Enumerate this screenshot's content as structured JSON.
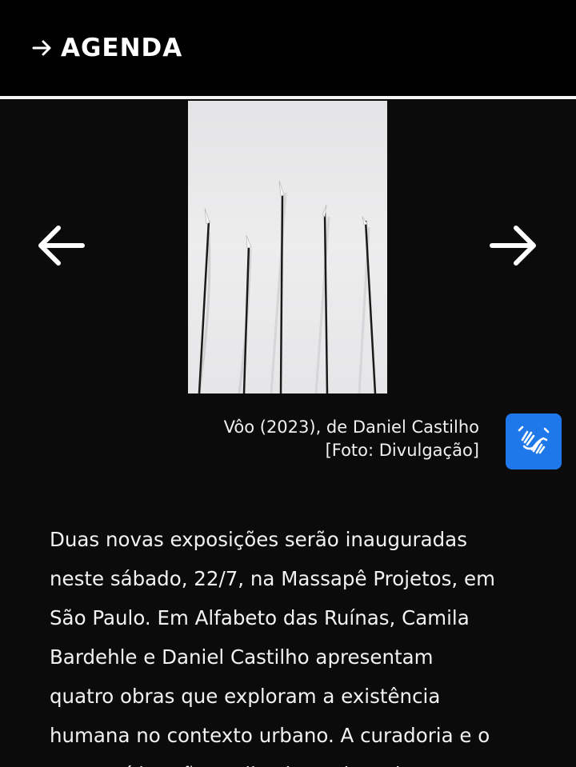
{
  "header": {
    "arrow_icon": "arrow-right-icon",
    "title": "AGENDA"
  },
  "carousel": {
    "prev_icon": "arrow-left-icon",
    "next_icon": "arrow-right-icon",
    "image": {
      "subject": "five thin black wire rods with white tips leaning against a white wall"
    },
    "caption": {
      "line1": "Vôo (2023), de Daniel Castilho",
      "line2": "[Foto: Divulgação]"
    }
  },
  "accessibility": {
    "libras_icon": "sign-language-hands-icon",
    "color": "#1e78ea"
  },
  "article": {
    "text": "Duas novas exposições serão inauguradas\nneste sábado, 22/7, na Massapê Projetos, em\nSão Paulo. Em Alfabeto das Ruínas, Camila\nBardehle e Daniel Castilho apresentam\nquatro obras que exploram a existência\nhumana no contexto urbano. A curadoria e o\ntexto crítico são realizados pelo artista"
  }
}
